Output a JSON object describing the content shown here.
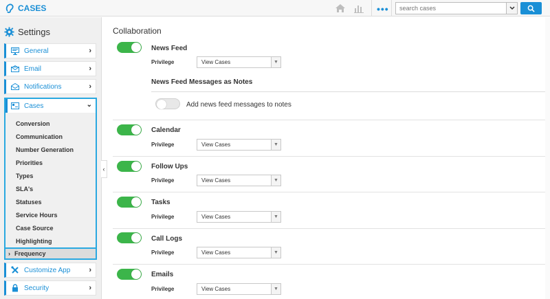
{
  "app": {
    "brand": "CASES"
  },
  "topbar": {
    "more_label": "•••",
    "search_placeholder": "search cases"
  },
  "sidebar": {
    "heading": "Settings",
    "items": [
      {
        "label": "General",
        "icon": "monitor-icon"
      },
      {
        "label": "Email",
        "icon": "envelope-icon"
      },
      {
        "label": "Notifications",
        "icon": "envelope-open-icon"
      },
      {
        "label": "Cases",
        "icon": "cases-icon"
      }
    ],
    "cases_sub": [
      "Conversion",
      "Communication",
      "Number Generation",
      "Priorities",
      "Types",
      "SLA's",
      "Statuses",
      "Service Hours",
      "Case Source",
      "Highlighting"
    ],
    "frequency_label": "Frequency",
    "bottom_items": [
      {
        "label": "Customize App",
        "icon": "tools-icon"
      },
      {
        "label": "Security",
        "icon": "lock-icon"
      }
    ]
  },
  "main": {
    "title": "Collaboration",
    "privilege_label": "Privilege",
    "notes_subtitle": "News Feed Messages as Notes",
    "notes_toggle_label": "Add news feed messages to notes",
    "sections": [
      {
        "title": "News Feed",
        "enabled": true,
        "privilege": "View Cases"
      },
      {
        "title": "Calendar",
        "enabled": true,
        "privilege": "View Cases"
      },
      {
        "title": "Follow Ups",
        "enabled": true,
        "privilege": "View Cases"
      },
      {
        "title": "Tasks",
        "enabled": true,
        "privilege": "View Cases"
      },
      {
        "title": "Call Logs",
        "enabled": true,
        "privilege": "View Cases"
      },
      {
        "title": "Emails",
        "enabled": true,
        "privilege": "View Cases"
      }
    ],
    "notes_enabled": false
  },
  "colors": {
    "accent": "#1a8fd6",
    "toggle_on": "#3cb54a",
    "highlight_border": "#29a8e0"
  }
}
